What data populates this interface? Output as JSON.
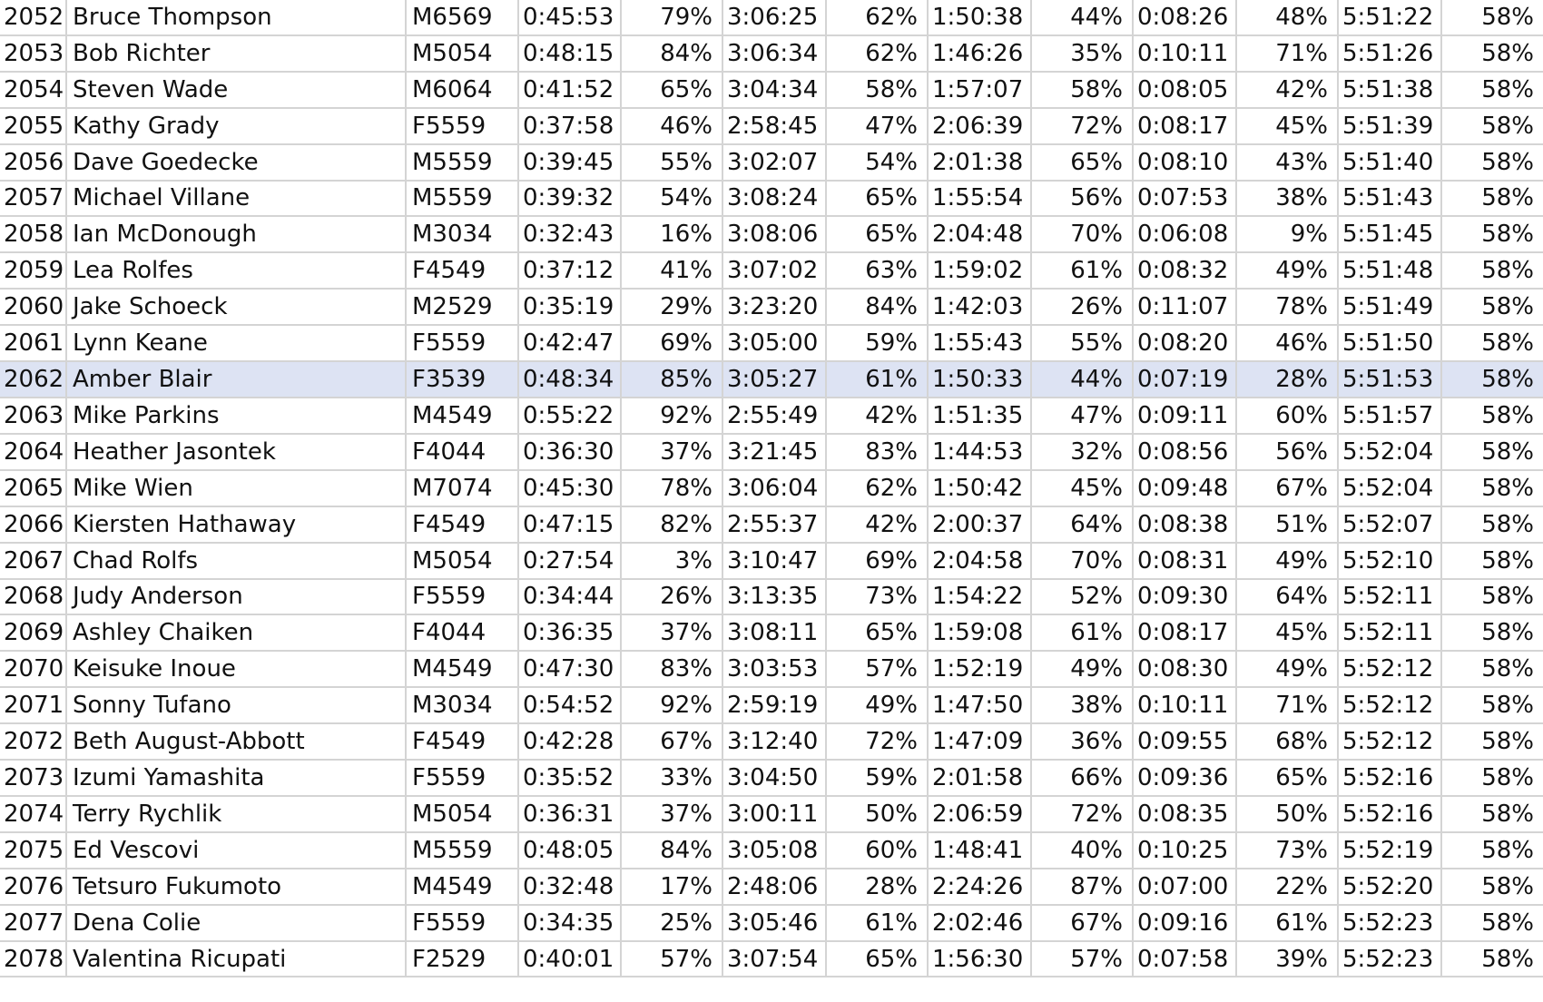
{
  "highlight_color": "#dde3f3",
  "selected_row_index": 10,
  "rows": [
    [
      "2052",
      "Bruce Thompson",
      "M6569",
      "0:45:53",
      "79%",
      "3:06:25",
      "62%",
      "1:50:38",
      "44%",
      "0:08:26",
      "48%",
      "5:51:22",
      "58%"
    ],
    [
      "2053",
      "Bob Richter",
      "M5054",
      "0:48:15",
      "84%",
      "3:06:34",
      "62%",
      "1:46:26",
      "35%",
      "0:10:11",
      "71%",
      "5:51:26",
      "58%"
    ],
    [
      "2054",
      "Steven Wade",
      "M6064",
      "0:41:52",
      "65%",
      "3:04:34",
      "58%",
      "1:57:07",
      "58%",
      "0:08:05",
      "42%",
      "5:51:38",
      "58%"
    ],
    [
      "2055",
      "Kathy Grady",
      "F5559",
      "0:37:58",
      "46%",
      "2:58:45",
      "47%",
      "2:06:39",
      "72%",
      "0:08:17",
      "45%",
      "5:51:39",
      "58%"
    ],
    [
      "2056",
      "Dave Goedecke",
      "M5559",
      "0:39:45",
      "55%",
      "3:02:07",
      "54%",
      "2:01:38",
      "65%",
      "0:08:10",
      "43%",
      "5:51:40",
      "58%"
    ],
    [
      "2057",
      "Michael Villane",
      "M5559",
      "0:39:32",
      "54%",
      "3:08:24",
      "65%",
      "1:55:54",
      "56%",
      "0:07:53",
      "38%",
      "5:51:43",
      "58%"
    ],
    [
      "2058",
      "Ian McDonough",
      "M3034",
      "0:32:43",
      "16%",
      "3:08:06",
      "65%",
      "2:04:48",
      "70%",
      "0:06:08",
      "9%",
      "5:51:45",
      "58%"
    ],
    [
      "2059",
      "Lea Rolfes",
      "F4549",
      "0:37:12",
      "41%",
      "3:07:02",
      "63%",
      "1:59:02",
      "61%",
      "0:08:32",
      "49%",
      "5:51:48",
      "58%"
    ],
    [
      "2060",
      "Jake Schoeck",
      "M2529",
      "0:35:19",
      "29%",
      "3:23:20",
      "84%",
      "1:42:03",
      "26%",
      "0:11:07",
      "78%",
      "5:51:49",
      "58%"
    ],
    [
      "2061",
      "Lynn Keane",
      "F5559",
      "0:42:47",
      "69%",
      "3:05:00",
      "59%",
      "1:55:43",
      "55%",
      "0:08:20",
      "46%",
      "5:51:50",
      "58%"
    ],
    [
      "2062",
      "Amber Blair",
      "F3539",
      "0:48:34",
      "85%",
      "3:05:27",
      "61%",
      "1:50:33",
      "44%",
      "0:07:19",
      "28%",
      "5:51:53",
      "58%"
    ],
    [
      "2063",
      "Mike Parkins",
      "M4549",
      "0:55:22",
      "92%",
      "2:55:49",
      "42%",
      "1:51:35",
      "47%",
      "0:09:11",
      "60%",
      "5:51:57",
      "58%"
    ],
    [
      "2064",
      "Heather Jasontek",
      "F4044",
      "0:36:30",
      "37%",
      "3:21:45",
      "83%",
      "1:44:53",
      "32%",
      "0:08:56",
      "56%",
      "5:52:04",
      "58%"
    ],
    [
      "2065",
      "Mike Wien",
      "M7074",
      "0:45:30",
      "78%",
      "3:06:04",
      "62%",
      "1:50:42",
      "45%",
      "0:09:48",
      "67%",
      "5:52:04",
      "58%"
    ],
    [
      "2066",
      "Kiersten Hathaway",
      "F4549",
      "0:47:15",
      "82%",
      "2:55:37",
      "42%",
      "2:00:37",
      "64%",
      "0:08:38",
      "51%",
      "5:52:07",
      "58%"
    ],
    [
      "2067",
      "Chad Rolfs",
      "M5054",
      "0:27:54",
      "3%",
      "3:10:47",
      "69%",
      "2:04:58",
      "70%",
      "0:08:31",
      "49%",
      "5:52:10",
      "58%"
    ],
    [
      "2068",
      "Judy Anderson",
      "F5559",
      "0:34:44",
      "26%",
      "3:13:35",
      "73%",
      "1:54:22",
      "52%",
      "0:09:30",
      "64%",
      "5:52:11",
      "58%"
    ],
    [
      "2069",
      "Ashley Chaiken",
      "F4044",
      "0:36:35",
      "37%",
      "3:08:11",
      "65%",
      "1:59:08",
      "61%",
      "0:08:17",
      "45%",
      "5:52:11",
      "58%"
    ],
    [
      "2070",
      "Keisuke Inoue",
      "M4549",
      "0:47:30",
      "83%",
      "3:03:53",
      "57%",
      "1:52:19",
      "49%",
      "0:08:30",
      "49%",
      "5:52:12",
      "58%"
    ],
    [
      "2071",
      "Sonny Tufano",
      "M3034",
      "0:54:52",
      "92%",
      "2:59:19",
      "49%",
      "1:47:50",
      "38%",
      "0:10:11",
      "71%",
      "5:52:12",
      "58%"
    ],
    [
      "2072",
      "Beth August-Abbott",
      "F4549",
      "0:42:28",
      "67%",
      "3:12:40",
      "72%",
      "1:47:09",
      "36%",
      "0:09:55",
      "68%",
      "5:52:12",
      "58%"
    ],
    [
      "2073",
      "Izumi Yamashita",
      "F5559",
      "0:35:52",
      "33%",
      "3:04:50",
      "59%",
      "2:01:58",
      "66%",
      "0:09:36",
      "65%",
      "5:52:16",
      "58%"
    ],
    [
      "2074",
      "Terry Rychlik",
      "M5054",
      "0:36:31",
      "37%",
      "3:00:11",
      "50%",
      "2:06:59",
      "72%",
      "0:08:35",
      "50%",
      "5:52:16",
      "58%"
    ],
    [
      "2075",
      "Ed Vescovi",
      "M5559",
      "0:48:05",
      "84%",
      "3:05:08",
      "60%",
      "1:48:41",
      "40%",
      "0:10:25",
      "73%",
      "5:52:19",
      "58%"
    ],
    [
      "2076",
      "Tetsuro Fukumoto",
      "M4549",
      "0:32:48",
      "17%",
      "2:48:06",
      "28%",
      "2:24:26",
      "87%",
      "0:07:00",
      "22%",
      "5:52:20",
      "58%"
    ],
    [
      "2077",
      "Dena Colie",
      "F5559",
      "0:34:35",
      "25%",
      "3:05:46",
      "61%",
      "2:02:46",
      "67%",
      "0:09:16",
      "61%",
      "5:52:23",
      "58%"
    ],
    [
      "2078",
      "Valentina Ricupati",
      "F2529",
      "0:40:01",
      "57%",
      "3:07:54",
      "65%",
      "1:56:30",
      "57%",
      "0:07:58",
      "39%",
      "5:52:23",
      "58%"
    ]
  ]
}
